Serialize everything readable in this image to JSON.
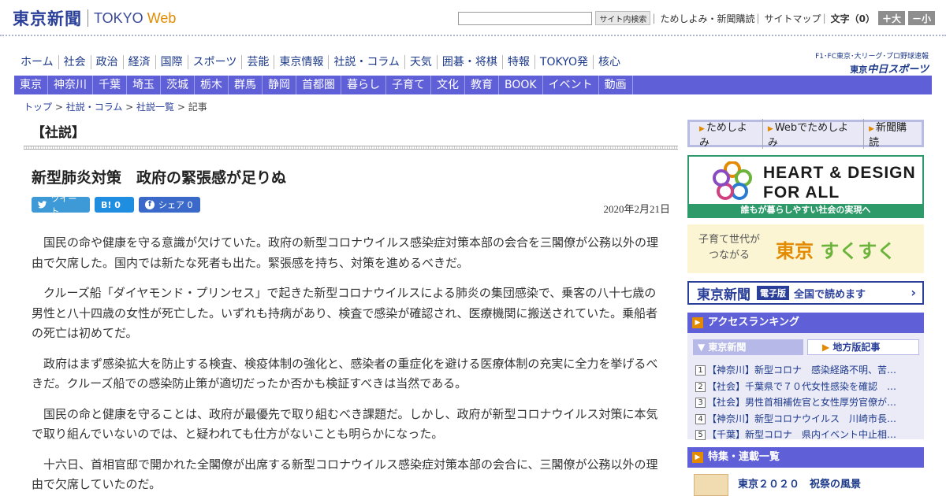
{
  "header": {
    "logo_jp": "東京新聞",
    "logo_en_a": "TOKYO ",
    "logo_en_b": "Web",
    "search_button": "サイト内検索",
    "link_trial": "ためしよみ・新聞購読",
    "link_sitemap": "サイトマップ",
    "font_size_label": "文字（0）",
    "bigger": "＋大",
    "smaller": "－小"
  },
  "main_nav": [
    "ホーム",
    "社会",
    "政治",
    "経済",
    "国際",
    "スポーツ",
    "芸能",
    "東京情報",
    "社説・コラム",
    "天気",
    "囲碁・将棋",
    "特報",
    "TOKYO発",
    "核心"
  ],
  "chunichi": {
    "top": "F1･FC東京･大リーグ･プロ野球速報",
    "prefix": "東京",
    "name": "中日スポーツ"
  },
  "local_nav": [
    "東京",
    "神奈川",
    "千葉",
    "埼玉",
    "茨城",
    "栃木",
    "群馬",
    "静岡",
    "首都圏",
    "暮らし",
    "子育て",
    "文化",
    "教育",
    "BOOK",
    "イベント",
    "動画"
  ],
  "breadcrumb": {
    "top": "トップ",
    "c1": "社説・コラム",
    "c2": "社説一覧",
    "current": "記事"
  },
  "article": {
    "section": "【社説】",
    "headline": "新型肺炎対策　政府の緊張感が足りぬ",
    "tweet": "ツイート",
    "hatena": "B! 0",
    "facebook": "シェア 0",
    "date": "2020年2月21日",
    "paragraphs": [
      "国民の命や健康を守る意識が欠けていた。政府の新型コロナウイルス感染症対策本部の会合を三閣僚が公務以外の理由で欠席した。国内では新たな死者も出た。緊張感を持ち、対策を進めるべきだ。",
      "クルーズ船「ダイヤモンド・プリンセス」で起きた新型コロナウイルスによる肺炎の集団感染で、乗客の八十七歳の男性と八十四歳の女性が死亡した。いずれも持病があり、検査で感染が確認され、医療機関に搬送されていた。乗船者の死亡は初めてだ。",
      "政府はまず感染拡大を防止する検査、検疫体制の強化と、感染者の重症化を避ける医療体制の充実に全力を挙げるべきだ。クルーズ船での感染防止策が適切だったか否かも検証すべきは当然である。",
      "国民の命と健康を守ることは、政府が最優先で取り組むべき課題だ。しかし、政府が新型コロナウイルス対策に本気で取り組んでいないのでは、と疑われても仕方がないことも明らかになった。",
      "十六日、首相官邸で開かれた全閣僚が出席する新型コロナウイルス感染症対策本部の会合に、三閣僚が公務以外の理由で欠席していたのだ。"
    ]
  },
  "sidebar": {
    "trial": [
      "ためしよみ",
      "Webでためしよみ",
      "新聞購読"
    ],
    "heart_line1": "HEART & DESIGN",
    "heart_line2": "FOR ALL",
    "heart_foot": "誰もが暮らしやすい社会の実現へ",
    "suku_line1": "子育て世代が",
    "suku_line2": "つながる",
    "suku_a": "東京",
    "suku_b": "すくすく",
    "denshi_logo": "東京新聞",
    "denshi_tag": "電子版",
    "denshi_msg": "全国で読めます",
    "ranking_title": "アクセスランキング",
    "ranking_tab1": "東京新聞",
    "ranking_tab2": "地方版記事",
    "ranking": [
      "【神奈川】新型コロナ　感染経路不明、苦…",
      "【社会】千葉県で７０代女性感染を確認　…",
      "【社会】男性首相補佐官と女性厚労官僚が…",
      "【神奈川】新型コロナウイルス　川崎市長…",
      "【千葉】新型コロナ　県内イベント中止相…"
    ],
    "feature_title": "特集・連載一覧",
    "feature_item": "東京２０２０　祝祭の風景"
  },
  "colors": {
    "brand_blue": "#2a3f9a",
    "nav_purple": "#5f5fd8",
    "accent_orange": "#e48a00",
    "green": "#2e9a6a"
  }
}
